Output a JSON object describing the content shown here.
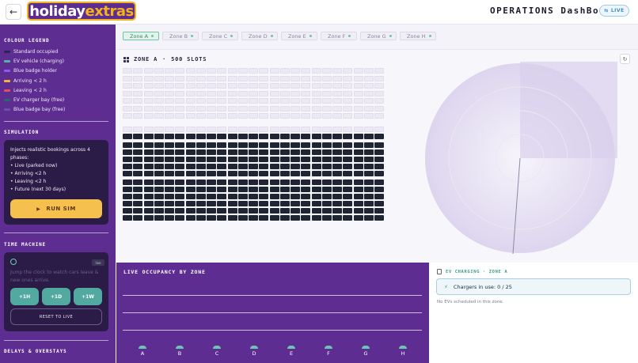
{
  "header": {
    "back_icon": "arrow-left-icon",
    "logo_part1": "holiday",
    "logo_part2": "extras",
    "title": "OPERATIONS DashBoard",
    "live_label": "LIVE"
  },
  "sidebar": {
    "legend": {
      "title": "COLOUR LEGEND",
      "items": [
        {
          "label": "Standard occupied",
          "color": "#2e2452"
        },
        {
          "label": "EV vehicle (charging)",
          "color": "#4fb3a8"
        },
        {
          "label": "Blue badge holder",
          "color": "#8a5cf0"
        },
        {
          "label": "Arriving < 2 h",
          "color": "#f4b43c"
        },
        {
          "label": "Leaving < 2 h",
          "color": "#e04e60"
        },
        {
          "label": "EV charger bay (free)",
          "color": "#2a6670"
        },
        {
          "label": "Blue badge bay (free)",
          "color": "#6b4fb0"
        }
      ]
    },
    "simulation": {
      "title": "SIMULATION",
      "description_lines": [
        "Injects realistic bookings across 4",
        "phases:",
        "• Live (parked now)",
        "• Arriving <2 h",
        "• Leaving <2 h",
        "• Future (next 30 days)"
      ],
      "run_label": "RUN SIM"
    },
    "time_machine": {
      "title": "TIME MACHINE",
      "tag": "live",
      "description_lines": [
        "Jump the clock to watch cars leave &",
        "new ones arrive."
      ],
      "buttons": [
        "+1H",
        "+1D",
        "+1W"
      ],
      "reset_label": "RESET TO LIVE"
    },
    "delays_title": "DELAYS & OVERSTAYS"
  },
  "zones": {
    "tabs": [
      "Zone A",
      "Zone B",
      "Zone C",
      "Zone D",
      "Zone E",
      "Zone F",
      "Zone G",
      "Zone H"
    ],
    "active": 0
  },
  "zone_view": {
    "zone_name": "ZONE A",
    "separator": "·",
    "slots_label": "500 SLOTS",
    "free_color": "#ece9f4",
    "occupied_color": "#1f2533"
  },
  "occupancy": {
    "title": "LIVE OCCUPANCY BY ZONE",
    "zones": [
      "A",
      "B",
      "C",
      "D",
      "E",
      "F",
      "G",
      "H"
    ]
  },
  "ev_charging": {
    "title": "EV CHARGING · ZONE A",
    "chargers_label": "Chargers in use: 0 / 25",
    "empty_message": "No EVs scheduled in this zone."
  }
}
